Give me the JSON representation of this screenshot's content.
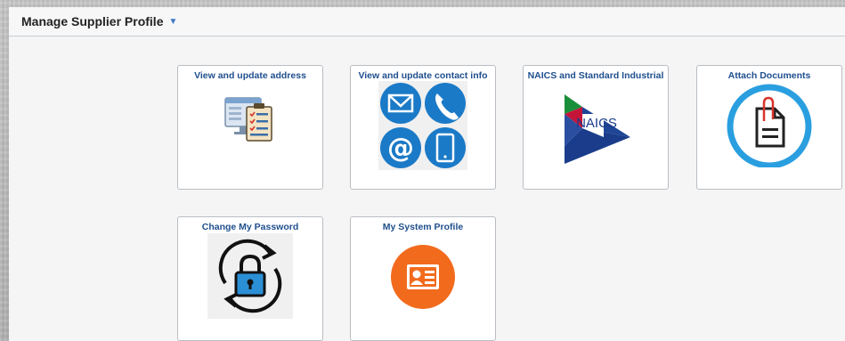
{
  "header": {
    "title": "Manage Supplier Profile"
  },
  "tiles": [
    {
      "title": "View and update address",
      "icon": "address-form-icon"
    },
    {
      "title": "View and update contact info",
      "icon": "contact-icons"
    },
    {
      "title": "NAICS and Standard Industrial",
      "icon": "naics-logo",
      "logo_text": "NAICS"
    },
    {
      "title": "Attach Documents",
      "icon": "attach-document-icon"
    },
    {
      "title": "Change My Password",
      "icon": "lock-refresh-icon"
    },
    {
      "title": "My System Profile",
      "icon": "profile-card-icon"
    }
  ],
  "colors": {
    "title_blue": "#1f4f8e",
    "accent_blue": "#3b78c2",
    "contact_blue": "#1b7ac7",
    "attach_ring": "#2a9fe0",
    "profile_orange": "#f26b1d",
    "naics_red": "#c4143a",
    "naics_green": "#1a8f3a",
    "naics_blue": "#1a3c8a"
  }
}
